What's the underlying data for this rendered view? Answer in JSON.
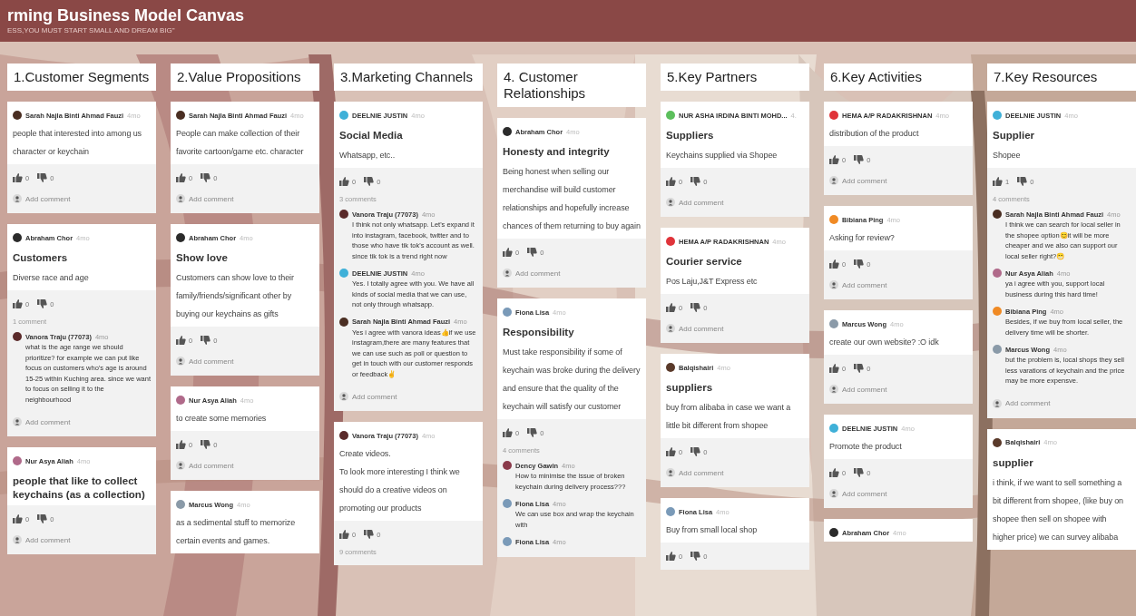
{
  "board": {
    "title": "rming Business Model Canvas",
    "subtitle": "ESS,YOU MUST START SMALL AND DREAM BIG\""
  },
  "columns": [
    {
      "title": "1.Customer Segments",
      "posts": [
        {
          "author": "Sarah Najla Binti Ahmad Fauzi",
          "time": "4mo",
          "color": "#4a2e22",
          "body": "people that interested into among us character or keychain",
          "likes": "0",
          "dislikes": "0",
          "add_comment": "Add comment"
        },
        {
          "author": "Abraham Chor",
          "time": "4mo",
          "color": "#2b2b2b",
          "title": "Customers",
          "body": "Diverse race and age",
          "likes": "0",
          "dislikes": "0",
          "comment_count": "1 comment",
          "comments": [
            {
              "author": "Vanora Traju (77073)",
              "time": "4mo",
              "color": "#5a2a2a",
              "text": "what is the age range we should prioritize? for example we can put like focus on customers who's age is around 15-25 within Kuching area. since we want to focus on selling it to the neighbourhood"
            }
          ],
          "add_comment": "Add comment"
        },
        {
          "author": "Nur Asya Aliah",
          "time": "4mo",
          "color": "#b06a8a",
          "title": "people that like to collect keychains (as a collection)",
          "likes": "0",
          "dislikes": "0",
          "add_comment": "Add comment"
        }
      ]
    },
    {
      "title": "2.Value Propositions",
      "posts": [
        {
          "author": "Sarah Najla Binti Ahmad Fauzi",
          "time": "4mo",
          "color": "#4a2e22",
          "body": "People can make collection of their favorite cartoon/game etc. character",
          "likes": "0",
          "dislikes": "0",
          "add_comment": "Add comment"
        },
        {
          "author": "Abraham Chor",
          "time": "4mo",
          "color": "#2b2b2b",
          "title": "Show love",
          "body": "Customers can show love to their family/friends/significant other by buying our keychains as gifts",
          "likes": "0",
          "dislikes": "0",
          "add_comment": "Add comment"
        },
        {
          "author": "Nur Asya Aliah",
          "time": "4mo",
          "color": "#b06a8a",
          "body": "to create some memories",
          "likes": "0",
          "dislikes": "0",
          "add_comment": "Add comment"
        },
        {
          "author": "Marcus Wong",
          "time": "4mo",
          "color": "#8a9aa8",
          "body": "as a sedimental stuff to memorize certain events and games."
        }
      ]
    },
    {
      "title": "3.Marketing Channels",
      "posts": [
        {
          "author": "DEELNIE JUSTIN",
          "time": "4mo",
          "color": "#3fb0d8",
          "title": "Social Media",
          "body": "Whatsapp, etc..",
          "likes": "0",
          "dislikes": "0",
          "comment_count": "3 comments",
          "comments": [
            {
              "author": "Vanora Traju (77073)",
              "time": "4mo",
              "color": "#5a2a2a",
              "text": "I think not only whatsapp. Let's expand it into instagram, facebook, twitter and to those who have tik tok's account as well. since tik tok is a trend right now"
            },
            {
              "author": "DEELNIE JUSTIN",
              "time": "4mo",
              "color": "#3fb0d8",
              "text": "Yes. I totally agree with you. We have all kinds of social media that we can use, not only through whatsapp."
            },
            {
              "author": "Sarah Najla Binti Ahmad Fauzi",
              "time": "4mo",
              "color": "#4a2e22",
              "text": "Yes i agree with vanora ideas👍if we use instagram,there are many features that we can use such as poll or question to get in touch with our customer responds or feedback✌"
            }
          ],
          "add_comment": "Add comment"
        },
        {
          "author": "Vanora Traju (77073)",
          "time": "4mo",
          "color": "#5a2a2a",
          "body": "Create videos.\nTo look more interesting I think we should do a creative videos on promoting our products",
          "likes": "0",
          "dislikes": "0",
          "comment_count": "9 comments"
        }
      ]
    },
    {
      "title": "4. Customer Relationships",
      "posts": [
        {
          "author": "Abraham Chor",
          "time": "4mo",
          "color": "#2b2b2b",
          "title": "Honesty and integrity",
          "body": "Being honest when selling our merchandise will build customer relationships and hopefully increase chances of them returning to buy again",
          "likes": "0",
          "dislikes": "0",
          "add_comment": "Add comment"
        },
        {
          "author": "Fiona Lisa",
          "time": "4mo",
          "color": "#7a9ab8",
          "title": "Responsibility",
          "body": "Must take responsibility if some of keychain was broke during the delivery and ensure that the quality of the keychain will satisfy our customer",
          "likes": "0",
          "dislikes": "0",
          "comment_count": "4 comments",
          "comments": [
            {
              "author": "Dency Gawin",
              "time": "4mo",
              "color": "#8a3a4a",
              "text": "How to minimise the issue of broken keychain during delivery process???"
            },
            {
              "author": "Fiona Lisa",
              "time": "4mo",
              "color": "#7a9ab8",
              "text": "We can use box and wrap the keychain with"
            },
            {
              "author": "Fiona Lisa",
              "time": "4mo",
              "color": "#7a9ab8"
            }
          ]
        }
      ]
    },
    {
      "title": "5.Key Partners",
      "posts": [
        {
          "author": "NUR ASHA IRDINA BINTI MOHD...",
          "time": "4.",
          "color": "#5cbf5c",
          "title": "Suppliers",
          "body": "Keychains supplied via Shopee",
          "likes": "0",
          "dislikes": "0",
          "add_comment": "Add comment"
        },
        {
          "author": "HEMA A/P RADAKRISHNAN",
          "time": "4mo",
          "color": "#e0343a",
          "title": "Courier service",
          "body": "Pos Laju,J&T Express etc",
          "likes": "0",
          "dislikes": "0",
          "add_comment": "Add comment"
        },
        {
          "author": "Balqishairi",
          "time": "4mo",
          "color": "#5a3a2a",
          "title": "suppliers",
          "body": "buy from alibaba in case we want a little bit different from shopee",
          "likes": "0",
          "dislikes": "0",
          "add_comment": "Add comment"
        },
        {
          "author": "Fiona Lisa",
          "time": "4mo",
          "color": "#7a9ab8",
          "body": "Buy from small local shop",
          "likes": "0",
          "dislikes": "0"
        }
      ]
    },
    {
      "title": "6.Key Activities",
      "posts": [
        {
          "author": "HEMA A/P RADAKRISHNAN",
          "time": "4mo",
          "color": "#e0343a",
          "body": "distribution of the product",
          "likes": "0",
          "dislikes": "0",
          "add_comment": "Add comment"
        },
        {
          "author": "Bibiana Ping",
          "time": "4mo",
          "color": "#f08a24",
          "body": "Asking for review?",
          "likes": "0",
          "dislikes": "0",
          "add_comment": "Add comment"
        },
        {
          "author": "Marcus Wong",
          "time": "4mo",
          "color": "#8a9aa8",
          "body": "create our own website? :O idk",
          "likes": "0",
          "dislikes": "0",
          "add_comment": "Add comment"
        },
        {
          "author": "DEELNIE JUSTIN",
          "time": "4mo",
          "color": "#3fb0d8",
          "body": "Promote the product",
          "likes": "0",
          "dislikes": "0",
          "add_comment": "Add comment"
        },
        {
          "author": "Abraham Chor",
          "time": "4mo",
          "color": "#2b2b2b"
        }
      ]
    },
    {
      "title": "7.Key Resources",
      "posts": [
        {
          "author": "DEELNIE JUSTIN",
          "time": "4mo",
          "color": "#3fb0d8",
          "title": "Supplier",
          "body": "Shopee",
          "likes": "1",
          "dislikes": "0",
          "comment_count": "4 comments",
          "comments": [
            {
              "author": "Sarah Najla Binti Ahmad Fauzi",
              "time": "4mo",
              "color": "#4a2e22",
              "text": "I think we can search for local seller in the shopee option😊it will be more cheaper and we also can support our local seller right?😁"
            },
            {
              "author": "Nur Asya Aliah",
              "time": "4mo",
              "color": "#b06a8a",
              "text": "ya i agree with you, support local business during this hard time!"
            },
            {
              "author": "Bibiana Ping",
              "time": "4mo",
              "color": "#f08a24",
              "text": "Besides, if we buy from local seller, the delivery time will be shorter."
            },
            {
              "author": "Marcus Wong",
              "time": "4mo",
              "color": "#8a9aa8",
              "text": "but the problem is, local shops they sell less varations of keychain and the price may be more expensve."
            }
          ],
          "add_comment": "Add comment"
        },
        {
          "author": "Balqishairi",
          "time": "4mo",
          "color": "#5a3a2a",
          "title": "supplier",
          "body": "i think, if we want to sell something a bit different from shopee, (like buy on shopee then sell on shopee with higher price) we can survey alibaba"
        }
      ]
    }
  ]
}
